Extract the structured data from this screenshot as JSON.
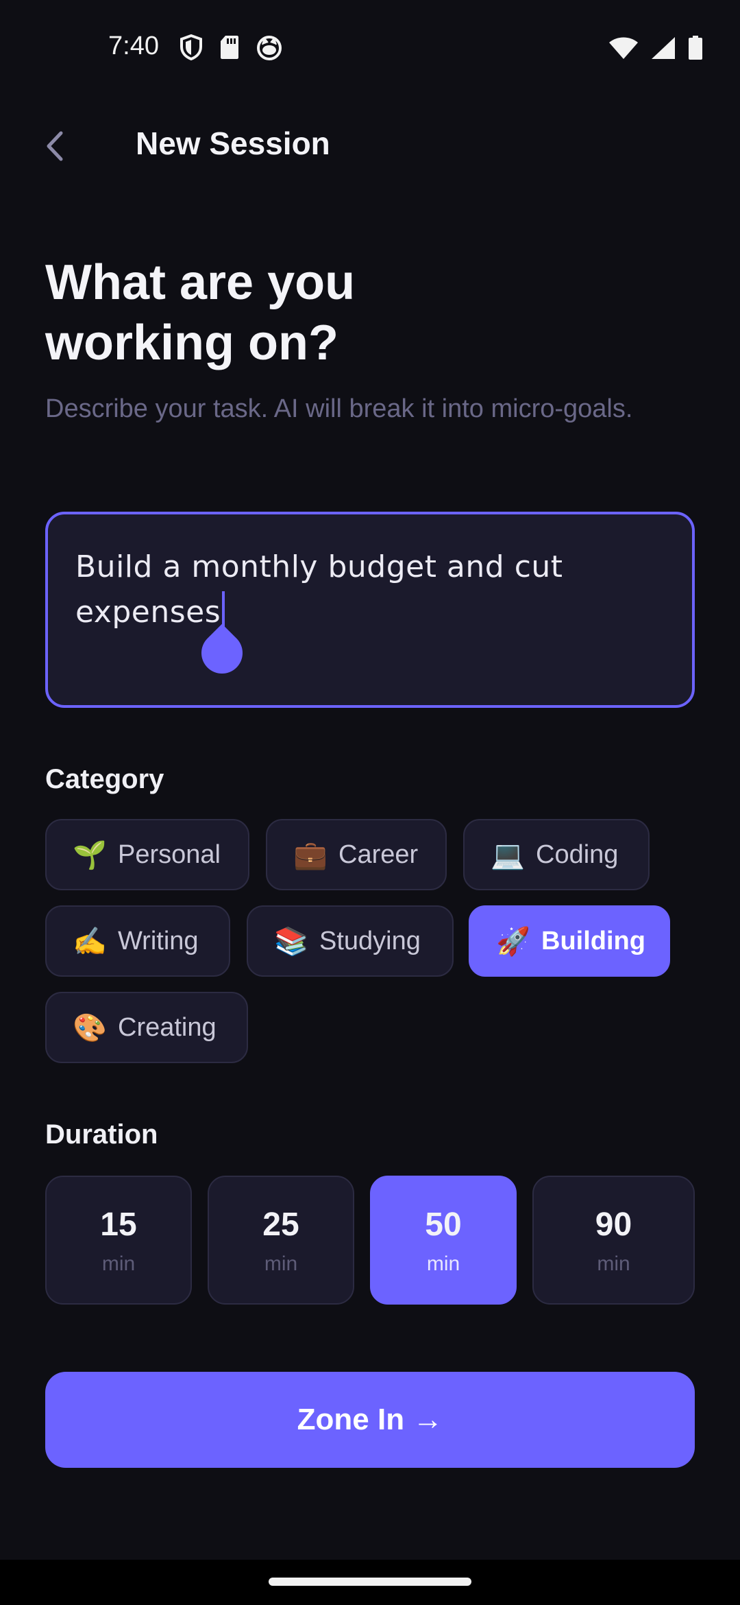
{
  "status_bar": {
    "time": "7:40"
  },
  "header": {
    "title": "New Session"
  },
  "intro": {
    "heading_line1": "What are you",
    "heading_line2": "working on?",
    "subheading": "Describe your task. AI will break it into micro-goals."
  },
  "task_input": {
    "line1": "Build a monthly budget and cut",
    "line2": "expenses"
  },
  "category": {
    "label": "Category",
    "options": [
      {
        "emoji": "🌱",
        "label": "Personal"
      },
      {
        "emoji": "💼",
        "label": "Career"
      },
      {
        "emoji": "💻",
        "label": "Coding"
      },
      {
        "emoji": "✍️",
        "label": "Writing"
      },
      {
        "emoji": "📚",
        "label": "Studying"
      },
      {
        "emoji": "🚀",
        "label": "Building",
        "selected": true
      },
      {
        "emoji": "🎨",
        "label": "Creating"
      }
    ]
  },
  "duration": {
    "label": "Duration",
    "options": [
      {
        "value": "15",
        "unit": "min"
      },
      {
        "value": "25",
        "unit": "min"
      },
      {
        "value": "50",
        "unit": "min",
        "selected": true
      },
      {
        "value": "90",
        "unit": "min"
      }
    ]
  },
  "cta": {
    "label": "Zone In →"
  },
  "colors": {
    "accent": "#6c63ff",
    "background": "#0e0e14",
    "surface": "#1b1a2c"
  }
}
